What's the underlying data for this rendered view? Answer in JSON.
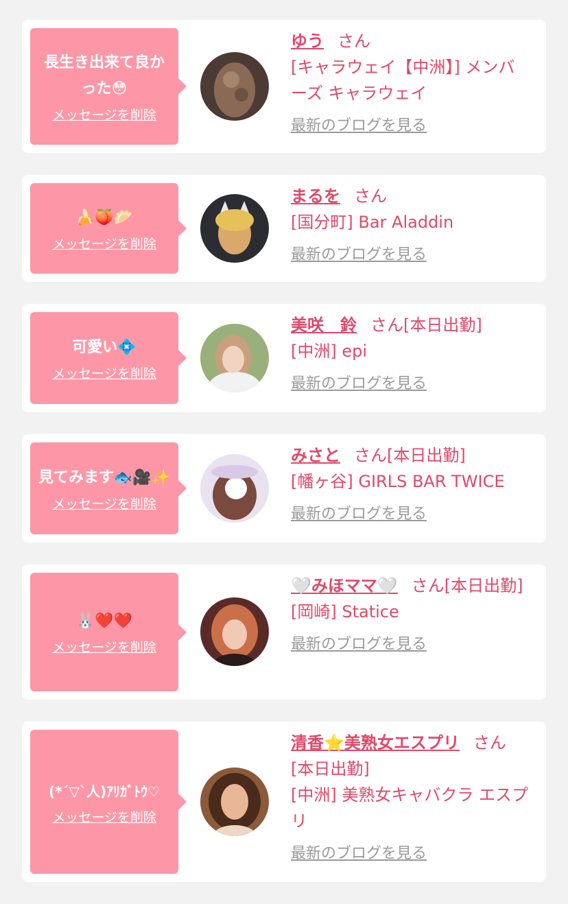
{
  "cards": [
    {
      "message": "長生き出来て良かった😳",
      "delete_label": "メッセージを削除",
      "name": "ゆう",
      "honorific": "さん",
      "status": "",
      "shop": "[キャラウェイ【中洲】] メンバーズ キャラウェイ",
      "blog_label": "最新のブログを見る"
    },
    {
      "message": "🍌🍑🥟",
      "delete_label": "メッセージを削除",
      "name": "まるを",
      "honorific": "さん",
      "status": "",
      "shop": "[国分町] Bar Aladdin",
      "blog_label": "最新のブログを見る"
    },
    {
      "message": "可愛い💠",
      "delete_label": "メッセージを削除",
      "name": "美咲　鈴",
      "honorific": "さん",
      "status": "[本日出勤]",
      "shop": "[中洲] epi",
      "blog_label": "最新のブログを見る"
    },
    {
      "message": "見てみます🐟🎥✨",
      "delete_label": "メッセージを削除",
      "name": "みさと",
      "honorific": "さん",
      "status": "[本日出勤]",
      "shop": "[幡ヶ谷] GIRLS BAR TWICE",
      "blog_label": "最新のブログを見る"
    },
    {
      "message": "🐰❤️❤️",
      "delete_label": "メッセージを削除",
      "name": "🤍みほママ🤍",
      "honorific": "さん",
      "status": "[本日出勤]",
      "shop": "[岡崎] Statice",
      "blog_label": "最新のブログを見る"
    },
    {
      "message": "(*´▽`人)ｱﾘｶﾞﾄｳ♡",
      "delete_label": "メッセージを削除",
      "name": "清香⭐️美熟女エスプリ",
      "honorific": "さん",
      "status": "[本日出勤]",
      "shop": "[中洲] 美熟女キャバクラ エスプリ",
      "blog_label": "最新のブログを見る"
    }
  ],
  "colors": {
    "bubble": "#fd97a7",
    "accent": "#e0486a",
    "link_gray": "#9a9a9a"
  }
}
